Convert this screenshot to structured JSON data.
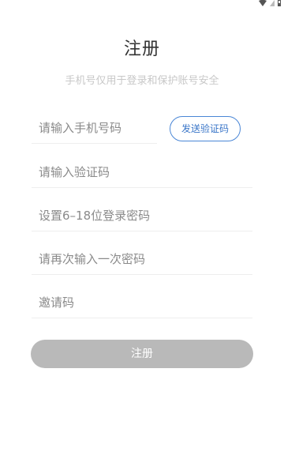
{
  "page": {
    "title": "注册",
    "subtitle": "手机号仅用于登录和保护账号安全"
  },
  "status_bar": {
    "icons": [
      "wifi-icon",
      "signal-icon",
      "battery-icon"
    ]
  },
  "form": {
    "phone": {
      "value": "",
      "placeholder": "请输入手机号码"
    },
    "send_code_label": "发送验证码",
    "verification_code": {
      "value": "",
      "placeholder": "请输入验证码"
    },
    "password": {
      "value": "",
      "placeholder": "设置6–18位登录密码"
    },
    "password_confirm": {
      "value": "",
      "placeholder": "请再次输入一次密码"
    },
    "invite_code": {
      "value": "",
      "placeholder": "邀请码"
    },
    "submit_label": "注册"
  },
  "colors": {
    "accent": "#4a86d6",
    "submit_disabled": "#b9b9b9",
    "placeholder": "#8a8a8a",
    "subtitle": "#c8c8c8"
  }
}
